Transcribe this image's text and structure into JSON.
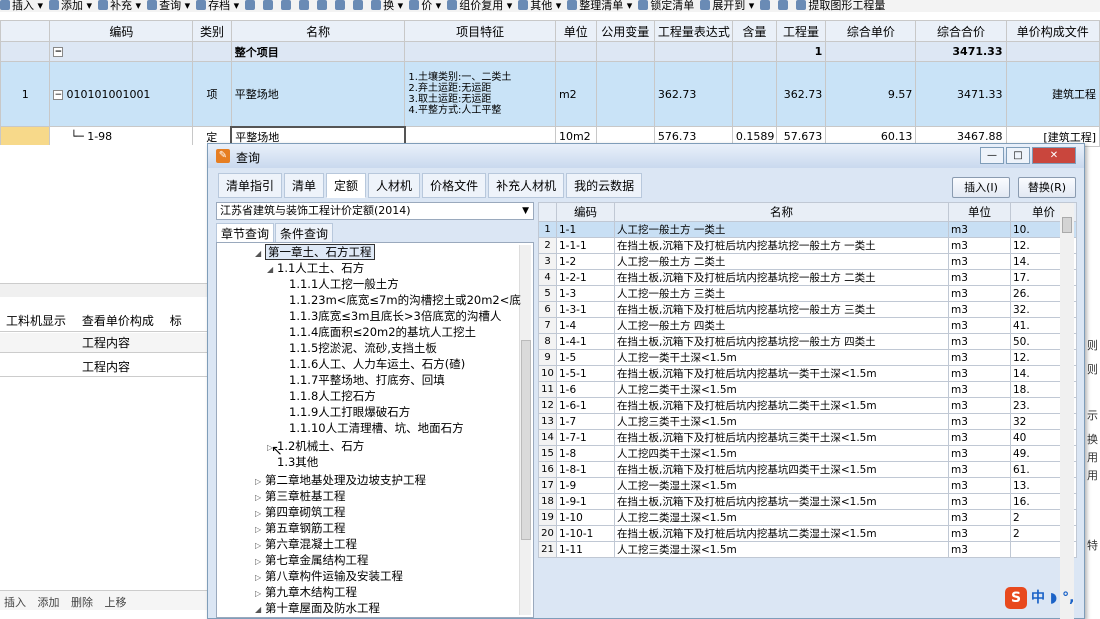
{
  "toolbar": {
    "items": [
      "插入 ▾",
      "添加 ▾",
      "补充 ▾",
      "查询 ▾",
      "存档 ▾",
      "",
      "",
      "",
      "",
      "",
      "",
      "",
      "换 ▾",
      "价 ▾",
      "组价复用 ▾",
      "其他 ▾",
      "整理清单 ▾",
      "锁定清单",
      "展开到 ▾",
      "",
      "",
      "提取图形工程量"
    ]
  },
  "grid": {
    "headers": [
      "编码",
      "类别",
      "名称",
      "项目特征",
      "单位",
      "公用变量",
      "工程量表达式",
      "含量",
      "工程量",
      "综合单价",
      "综合合价",
      "单价构成文件"
    ],
    "summary": {
      "name": "整个项目",
      "qty": "1",
      "total": "3471.33"
    },
    "main_row": {
      "index": "1",
      "code": "010101001001",
      "type": "项",
      "name": "平整场地",
      "feature": [
        "1.土壤类别:一、二类土",
        "2.弃土运距:无运距",
        "3.取土运距:无运距",
        "4.平整方式:人工平整"
      ],
      "unit": "m2",
      "expr": "362.73",
      "qty": "362.73",
      "unit_price": "9.57",
      "total": "3471.33",
      "file": "建筑工程"
    },
    "sub_row": {
      "code": "1-98",
      "type": "定",
      "name": "平整场地",
      "unit": "10m2",
      "expr": "576.73",
      "content": "0.1589",
      "qty": "57.673",
      "unit_price": "60.13",
      "total": "3467.88",
      "file": "[建筑工程]"
    }
  },
  "left_panel": {
    "tabs": [
      "工料机显示",
      "查看单价构成",
      "标"
    ],
    "header1": "工程内容",
    "header2": "工程内容",
    "buttons": [
      "插入",
      "添加",
      "删除",
      "上移"
    ]
  },
  "right_strip": [
    "则",
    "则",
    "示",
    "换",
    "用",
    "用",
    "特"
  ],
  "dialog": {
    "title": "查询",
    "window_buttons": [
      "—",
      "□",
      "✕"
    ],
    "tabs": [
      "清单指引",
      "清单",
      "定额",
      "人材机",
      "价格文件",
      "补充人材机",
      "我的云数据"
    ],
    "active_tab": "定额",
    "insert_btn": "插入(I)",
    "replace_btn": "替换(R)",
    "library": "江苏省建筑与装饰工程计价定额(2014)",
    "subtabs": [
      "章节查询",
      "条件查询"
    ],
    "tree": [
      {
        "label": "第一章土、石方工程",
        "level": 0,
        "toggle": "◢",
        "selected": true
      },
      {
        "label": "1.1人工土、石方",
        "level": 1,
        "toggle": "◢"
      },
      {
        "label": "1.1.1人工挖一般土方",
        "level": 2,
        "toggle": ""
      },
      {
        "label": "1.1.23m<底宽≤7m的沟槽挖土或20m2<底",
        "level": 2,
        "toggle": ""
      },
      {
        "label": "1.1.3底宽≤3m且底长>3倍底宽的沟槽人",
        "level": 2,
        "toggle": ""
      },
      {
        "label": "1.1.4底面积≤20m2的基坑人工挖土",
        "level": 2,
        "toggle": ""
      },
      {
        "label": "1.1.5挖淤泥、流砂,支挡土板",
        "level": 2,
        "toggle": ""
      },
      {
        "label": "1.1.6人工、人力车运土、石方(碴)",
        "level": 2,
        "toggle": ""
      },
      {
        "label": "1.1.7平整场地、打底夯、回填",
        "level": 2,
        "toggle": ""
      },
      {
        "label": "1.1.8人工挖石方",
        "level": 2,
        "toggle": ""
      },
      {
        "label": "1.1.9人工打眼爆破石方",
        "level": 2,
        "toggle": ""
      },
      {
        "label": "1.1.10人工清理槽、坑、地面石方",
        "level": 2,
        "toggle": ""
      },
      {
        "label": "1.2机械土、石方",
        "level": 1,
        "toggle": "▷"
      },
      {
        "label": "1.3其他",
        "level": 1,
        "toggle": ""
      },
      {
        "label": "第二章地基处理及边坡支护工程",
        "level": 0,
        "toggle": "▷"
      },
      {
        "label": "第三章桩基工程",
        "level": 0,
        "toggle": "▷"
      },
      {
        "label": "第四章砌筑工程",
        "level": 0,
        "toggle": "▷"
      },
      {
        "label": "第五章钢筋工程",
        "level": 0,
        "toggle": "▷"
      },
      {
        "label": "第六章混凝土工程",
        "level": 0,
        "toggle": "▷"
      },
      {
        "label": "第七章金属结构工程",
        "level": 0,
        "toggle": "▷"
      },
      {
        "label": "第八章构件运输及安装工程",
        "level": 0,
        "toggle": "▷"
      },
      {
        "label": "第九章木结构工程",
        "level": 0,
        "toggle": "▷"
      },
      {
        "label": "第十章屋面及防水工程",
        "level": 0,
        "toggle": "◢"
      }
    ],
    "table_headers": [
      "",
      "编码",
      "名称",
      "单位",
      "单价"
    ],
    "rows": [
      [
        "1",
        "1-1",
        "人工挖一般土方 一类土",
        "m3",
        "10."
      ],
      [
        "2",
        "1-1-1",
        "在挡土板,沉箱下及打桩后坑内挖基坑挖一般土方 一类土",
        "m3",
        "12."
      ],
      [
        "3",
        "1-2",
        "人工挖一般土方 二类土",
        "m3",
        "14."
      ],
      [
        "4",
        "1-2-1",
        "在挡土板,沉箱下及打桩后坑内挖基坑挖一般土方 二类土",
        "m3",
        "17."
      ],
      [
        "5",
        "1-3",
        "人工挖一般土方 三类土",
        "m3",
        "26."
      ],
      [
        "6",
        "1-3-1",
        "在挡土板,沉箱下及打桩后坑内挖基坑挖一般土方 三类土",
        "m3",
        "32."
      ],
      [
        "7",
        "1-4",
        "人工挖一般土方 四类土",
        "m3",
        "41."
      ],
      [
        "8",
        "1-4-1",
        "在挡土板,沉箱下及打桩后坑内挖基坑挖一般土方 四类土",
        "m3",
        "50."
      ],
      [
        "9",
        "1-5",
        "人工挖一类干土深<1.5m",
        "m3",
        "12."
      ],
      [
        "10",
        "1-5-1",
        "在挡土板,沉箱下及打桩后坑内挖基坑一类干土深<1.5m",
        "m3",
        "14."
      ],
      [
        "11",
        "1-6",
        "人工挖二类干土深<1.5m",
        "m3",
        "18."
      ],
      [
        "12",
        "1-6-1",
        "在挡土板,沉箱下及打桩后坑内挖基坑二类干土深<1.5m",
        "m3",
        "23."
      ],
      [
        "13",
        "1-7",
        "人工挖三类干土深<1.5m",
        "m3",
        "32"
      ],
      [
        "14",
        "1-7-1",
        "在挡土板,沉箱下及打桩后坑内挖基坑三类干土深<1.5m",
        "m3",
        "40"
      ],
      [
        "15",
        "1-8",
        "人工挖四类干土深<1.5m",
        "m3",
        "49."
      ],
      [
        "16",
        "1-8-1",
        "在挡土板,沉箱下及打桩后坑内挖基坑四类干土深<1.5m",
        "m3",
        "61."
      ],
      [
        "17",
        "1-9",
        "人工挖一类湿土深<1.5m",
        "m3",
        "13."
      ],
      [
        "18",
        "1-9-1",
        "在挡土板,沉箱下及打桩后坑内挖基坑一类湿土深<1.5m",
        "m3",
        "16."
      ],
      [
        "19",
        "1-10",
        "人工挖二类湿土深<1.5m",
        "m3",
        "2"
      ],
      [
        "20",
        "1-10-1",
        "在挡土板,沉箱下及打桩后坑内挖基坑二类湿土深<1.5m",
        "m3",
        "2"
      ],
      [
        "21",
        "1-11",
        "人工挖三类湿土深<1.5m",
        "m3",
        ""
      ]
    ]
  },
  "ime": {
    "label": "中 ◗ °,"
  },
  "colors": {
    "accent": "#c9e3f7",
    "header": "#eaf0f8",
    "dialog": "#dbe6f4"
  }
}
